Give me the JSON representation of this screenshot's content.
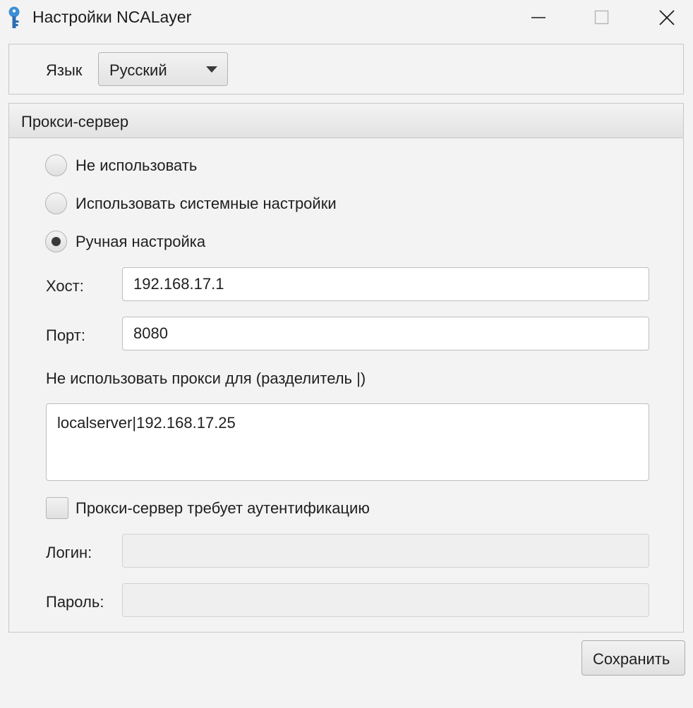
{
  "window": {
    "title": "Настройки NCALayer",
    "app_icon": "key-icon",
    "controls": [
      "minimize-icon",
      "maximize-icon",
      "close-icon"
    ]
  },
  "language": {
    "label": "Язык",
    "selected": "Русский"
  },
  "proxy": {
    "title": "Прокси-сервер",
    "options": [
      {
        "label": "Не использовать",
        "selected": false
      },
      {
        "label": "Использовать системные настройки",
        "selected": false
      },
      {
        "label": "Ручная настройка",
        "selected": true
      }
    ],
    "host": {
      "label": "Хост:",
      "value": "192.168.17.1"
    },
    "port": {
      "label": "Порт:",
      "value": "8080"
    },
    "bypass": {
      "label": "Не использовать прокси для (разделитель |)",
      "value": "localserver|192.168.17.25"
    },
    "auth": {
      "label": "Прокси-сервер требует аутентификацию",
      "checked": false
    },
    "login": {
      "label": "Логин:",
      "value": ""
    },
    "password": {
      "label": "Пароль:",
      "value": ""
    }
  },
  "actions": {
    "save_label": "Сохранить"
  }
}
